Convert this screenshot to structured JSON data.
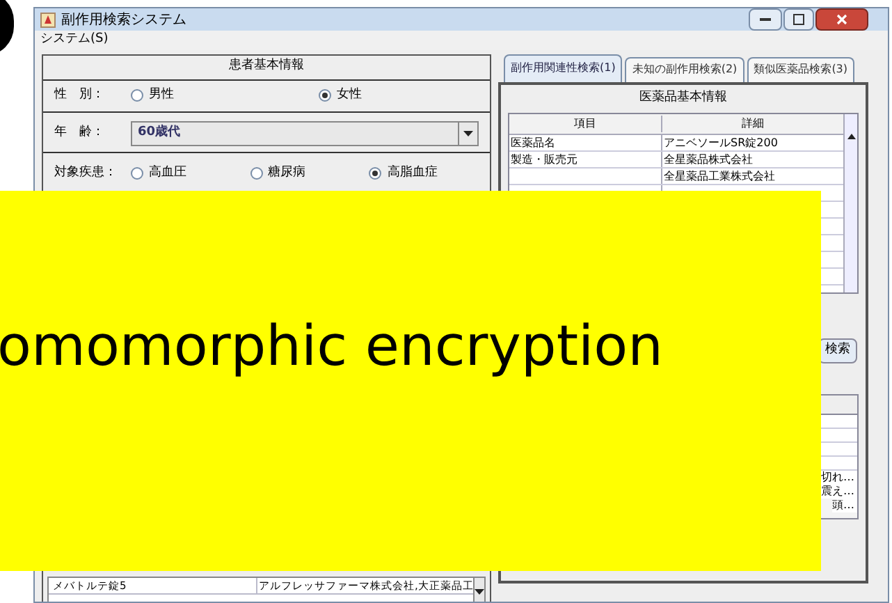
{
  "window": {
    "title": "副作用検索システム"
  },
  "menu": [
    {
      "label": "システム(S)"
    }
  ],
  "patient_info": {
    "title": "患者基本情報",
    "gender": {
      "label": "性　別：",
      "options": [
        {
          "label": "男性",
          "selected": false
        },
        {
          "label": "女性",
          "selected": true
        }
      ]
    },
    "age": {
      "label": "年　齢：",
      "value": "60歳代"
    },
    "disease": {
      "label": "対象疾患：",
      "options": [
        {
          "label": "高血圧",
          "selected": false
        },
        {
          "label": "糖尿病",
          "selected": false
        },
        {
          "label": "高脂血症",
          "selected": true
        }
      ]
    }
  },
  "results_table": {
    "rows": [
      {
        "name": "メバトルテ錠5",
        "maker": "アルフレッサファーマ株式会社,大正薬品工"
      }
    ]
  },
  "tabs": [
    {
      "label": "副作用関連性検索(1)",
      "selected": true
    },
    {
      "label": "未知の副作用検索(2)",
      "selected": false
    },
    {
      "label": "類似医薬品検索(3)",
      "selected": false
    }
  ],
  "drug_info": {
    "title": "医薬品基本情報",
    "columns": [
      "項目",
      "詳細"
    ],
    "rows": [
      {
        "item": "医薬品名",
        "detail": "アニベソールSR錠200"
      },
      {
        "item": "製造・販売元",
        "detail": "全星薬品株式会社"
      },
      {
        "detail": "全星薬品工業株式会社"
      }
    ]
  },
  "search_button": "検索",
  "side_effect_fragments": [
    "切れ…",
    "震え…",
    "頭…"
  ],
  "banner": {
    "text": "omomorphic encryption"
  }
}
